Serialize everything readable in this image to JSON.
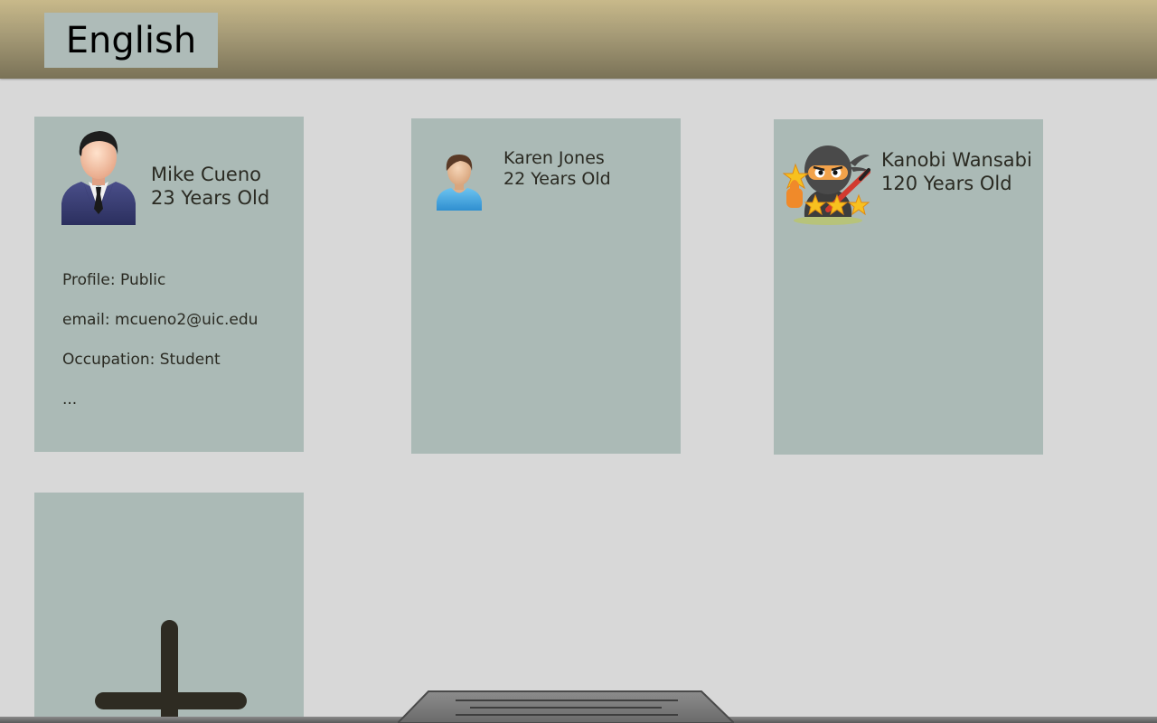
{
  "header": {
    "language_label": "English"
  },
  "contacts": [
    {
      "name": "Mike Cueno",
      "age": "23 Years Old",
      "avatar_icon": "businessman-avatar-icon",
      "details": [
        "Profile: Public",
        "email: mcueno2@uic.edu",
        "Occupation: Student",
        "..."
      ]
    },
    {
      "name": "Karen Jones",
      "age": "22 Years Old",
      "avatar_icon": "person-avatar-icon"
    },
    {
      "name": "Kanobi Wansabi",
      "age": "120 Years Old",
      "avatar_icon": "ninja-avatar-icon"
    }
  ],
  "add_contact": {
    "icon": "plus-icon"
  },
  "bottom_handle": {
    "icon": "drawer-handle-icon"
  },
  "colors": {
    "background": "#d8d8d8",
    "card": "#abbab6",
    "header_top": "#c8b98a",
    "header_bottom": "#7a7257",
    "text": "#2a2a22"
  }
}
